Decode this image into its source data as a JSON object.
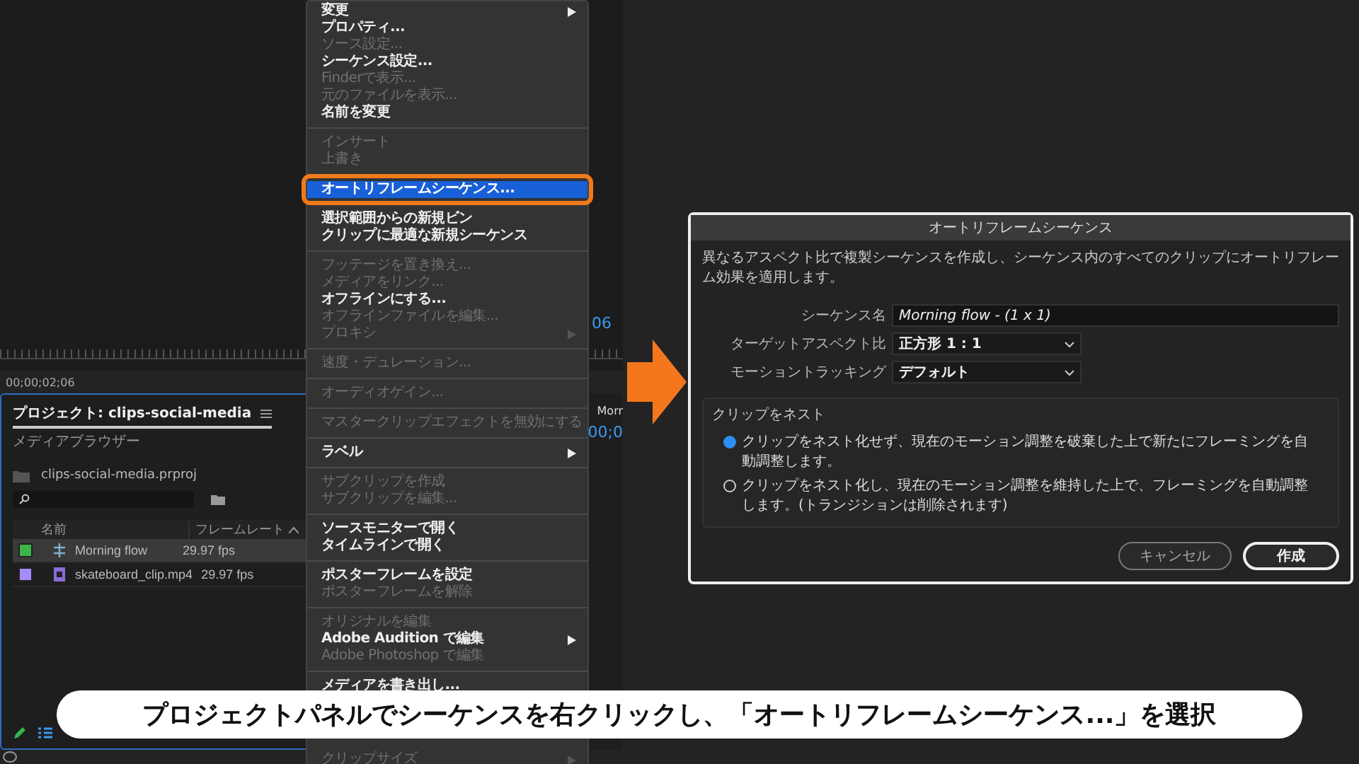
{
  "monitor": {
    "timecode_fragment": "06",
    "timecode": "00;00;02;06"
  },
  "project_panel": {
    "tabs": [
      {
        "label": "プロジェクト: clips-social-media",
        "selected": true
      },
      {
        "label": "メディアブラウザー",
        "selected": false
      }
    ],
    "project_file": "clips-social-media.prproj",
    "columns": [
      "名前",
      "フレームレート"
    ],
    "rows": [
      {
        "kind": "sequence",
        "name": "Morning flow",
        "frame_rate": "29.97 fps",
        "color": "#3cb44a",
        "selected": true
      },
      {
        "kind": "clip",
        "name": "skateboard_clip.mp4",
        "frame_rate": "29.97 fps",
        "color": "#a78bfa",
        "selected": false
      }
    ]
  },
  "timeline": {
    "tab": "Morr",
    "timecode": "00;0"
  },
  "context_menu": {
    "groups": [
      [
        {
          "label": "変更",
          "disabled": false,
          "submenu": true,
          "selected": false
        },
        {
          "label": "プロパティ...",
          "disabled": false,
          "submenu": false,
          "selected": false
        },
        {
          "label": "ソース設定...",
          "disabled": true,
          "submenu": false,
          "selected": false
        },
        {
          "label": "シーケンス設定...",
          "disabled": false,
          "submenu": false,
          "selected": false
        },
        {
          "label": "Finderで表示...",
          "disabled": true,
          "submenu": false,
          "selected": false
        },
        {
          "label": "元のファイルを表示...",
          "disabled": true,
          "submenu": false,
          "selected": false
        },
        {
          "label": "名前を変更",
          "disabled": false,
          "submenu": false,
          "selected": false
        }
      ],
      [
        {
          "label": "インサート",
          "disabled": true,
          "submenu": false,
          "selected": false
        },
        {
          "label": "上書き",
          "disabled": true,
          "submenu": false,
          "selected": false
        }
      ],
      [
        {
          "label": "オートリフレームシーケンス...",
          "disabled": false,
          "submenu": false,
          "selected": true
        }
      ],
      [
        {
          "label": "選択範囲からの新規ビン",
          "disabled": false,
          "submenu": false,
          "selected": false
        },
        {
          "label": "クリップに最適な新規シーケンス",
          "disabled": false,
          "submenu": false,
          "selected": false
        }
      ],
      [
        {
          "label": "フッテージを置き換え...",
          "disabled": true,
          "submenu": false,
          "selected": false
        },
        {
          "label": "メディアをリンク...",
          "disabled": true,
          "submenu": false,
          "selected": false
        },
        {
          "label": "オフラインにする...",
          "disabled": false,
          "submenu": false,
          "selected": false
        },
        {
          "label": "オフラインファイルを編集...",
          "disabled": true,
          "submenu": false,
          "selected": false
        },
        {
          "label": "プロキシ",
          "disabled": true,
          "submenu": true,
          "selected": false
        }
      ],
      [
        {
          "label": "速度・デュレーション...",
          "disabled": true,
          "submenu": false,
          "selected": false
        }
      ],
      [
        {
          "label": "オーディオゲイン...",
          "disabled": true,
          "submenu": false,
          "selected": false
        }
      ],
      [
        {
          "label": "マスタークリップエフェクトを無効にする",
          "disabled": true,
          "submenu": false,
          "selected": false
        }
      ],
      [
        {
          "label": "ラベル",
          "disabled": false,
          "submenu": true,
          "selected": false
        }
      ],
      [
        {
          "label": "サブクリップを作成",
          "disabled": true,
          "submenu": false,
          "selected": false
        },
        {
          "label": "サブクリップを編集...",
          "disabled": true,
          "submenu": false,
          "selected": false
        }
      ],
      [
        {
          "label": "ソースモニターで開く",
          "disabled": false,
          "submenu": false,
          "selected": false
        },
        {
          "label": "タイムラインで開く",
          "disabled": false,
          "submenu": false,
          "selected": false
        }
      ],
      [
        {
          "label": "ポスターフレームを設定",
          "disabled": false,
          "submenu": false,
          "selected": false
        },
        {
          "label": "ポスターフレームを解除",
          "disabled": true,
          "submenu": false,
          "selected": false
        }
      ],
      [
        {
          "label": "オリジナルを編集",
          "disabled": true,
          "submenu": false,
          "selected": false
        },
        {
          "label": "Adobe Audition で編集",
          "disabled": false,
          "submenu": true,
          "selected": false
        },
        {
          "label": "Adobe Photoshop で編集",
          "disabled": true,
          "submenu": false,
          "selected": false
        }
      ],
      [
        {
          "label": "メディアを書き出し...",
          "disabled": false,
          "submenu": false,
          "selected": false
        }
      ],
      [
        {
          "label": "クリップサイズ",
          "disabled": true,
          "submenu": true,
          "selected": false
        }
      ]
    ]
  },
  "dialog": {
    "title": "オートリフレームシーケンス",
    "description": "異なるアスペクト比で複製シーケンスを作成し、シーケンス内のすべてのクリップにオートリフレーム効果を適用します。",
    "fields": [
      {
        "kind": "text",
        "label": "シーケンス名",
        "value": "Morning flow - (1 x 1)"
      },
      {
        "kind": "dropdown",
        "label": "ターゲットアスペクト比",
        "value": "正方形 1 : 1"
      },
      {
        "kind": "dropdown",
        "label": "モーショントラッキング",
        "value": "デフォルト"
      }
    ],
    "nest": {
      "legend": "クリップをネスト",
      "options": [
        {
          "label": "クリップをネスト化せず、現在のモーション調整を破棄した上で新たにフレーミングを自動調整します。",
          "selected": true
        },
        {
          "label": "クリップをネスト化し、現在のモーション調整を維持した上で、フレーミングを自動調整します。(トランジションは削除されます)",
          "selected": false
        }
      ]
    },
    "buttons": [
      {
        "label": "キャンセル",
        "primary": false
      },
      {
        "label": "作成",
        "primary": true
      }
    ]
  },
  "caption": "プロジェクトパネルでシーケンスを右クリックし、「オートリフレームシーケンス...」を選択"
}
